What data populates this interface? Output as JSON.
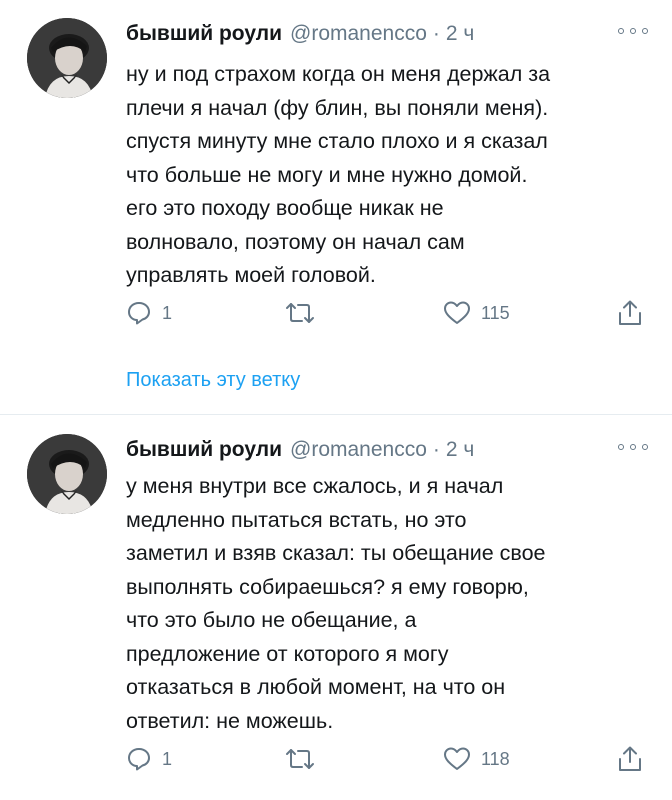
{
  "tweets": [
    {
      "author_name": "бывший роули",
      "handle": "@romanencco",
      "separator": "·",
      "time": "2 ч",
      "lines": [
        "ну и под страхом когда он меня держал за",
        "плечи я начал (фу блин, вы поняли меня).",
        "спустя минуту мне стало плохо и я сказал",
        "что больше не могу и мне нужно домой.",
        "его это походу вообще никак не",
        "волновало, поэтому он начал сам",
        "управлять моей головой."
      ],
      "replies": "1",
      "likes": "115",
      "show_thread": "Показать эту ветку"
    },
    {
      "author_name": "бывший роули",
      "handle": "@romanencco",
      "separator": "·",
      "time": "2 ч",
      "lines": [
        "у меня внутри все сжалось, и я начал",
        "медленно пытаться встать, но это",
        "заметил и взяв сказал: ты обещание свое",
        "выполнять собираешься? я ему говорю,",
        "что это было не обещание, а",
        "предложение от которого я могу",
        "отказаться в любой момент, на что он",
        "ответил: не можешь."
      ],
      "replies": "1",
      "likes": "118"
    }
  ],
  "icons": {
    "reply": "reply-icon",
    "retweet": "retweet-icon",
    "like": "heart-icon",
    "share": "share-icon",
    "more": "more-icon"
  },
  "colors": {
    "link": "#1da1f2",
    "secondary": "#657786",
    "text": "#14171a"
  }
}
